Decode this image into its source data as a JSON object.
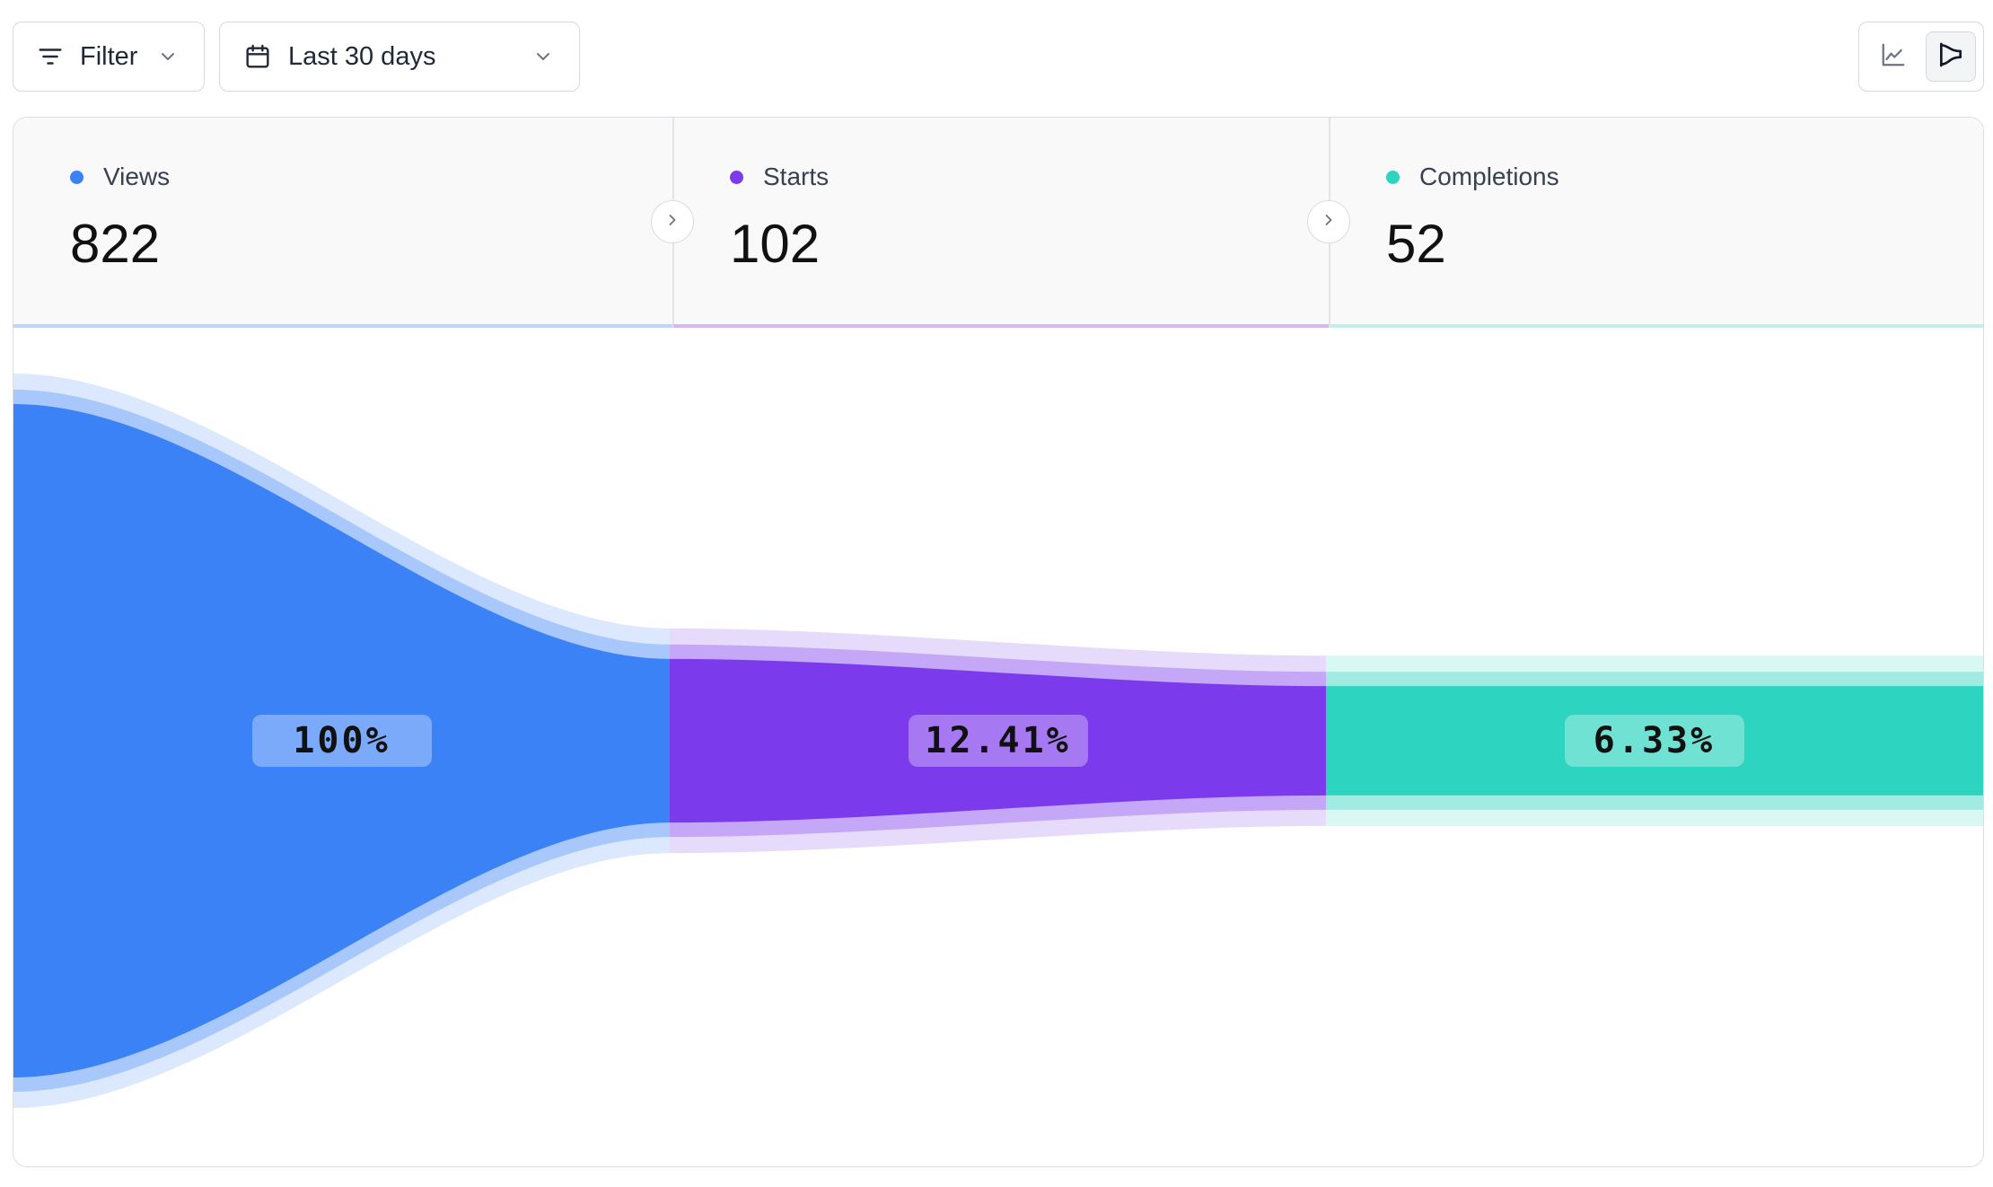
{
  "toolbar": {
    "filter_label": "Filter",
    "date_range_label": "Last 30 days",
    "view_options": [
      "line-chart-view",
      "funnel-view"
    ],
    "active_view": "funnel-view"
  },
  "steps": [
    {
      "name": "Views",
      "value": "822",
      "color": "#3b82f6",
      "percent_label": "100%"
    },
    {
      "name": "Starts",
      "value": "102",
      "color": "#7c3aed",
      "percent_label": "12.41%"
    },
    {
      "name": "Completions",
      "value": "52",
      "color": "#2dd4bf",
      "percent_label": "6.33%"
    }
  ],
  "chart_data": {
    "type": "funnel",
    "categories": [
      "Views",
      "Starts",
      "Completions"
    ],
    "values": [
      822,
      102,
      52
    ],
    "percentages": [
      100,
      12.41,
      6.33
    ]
  }
}
